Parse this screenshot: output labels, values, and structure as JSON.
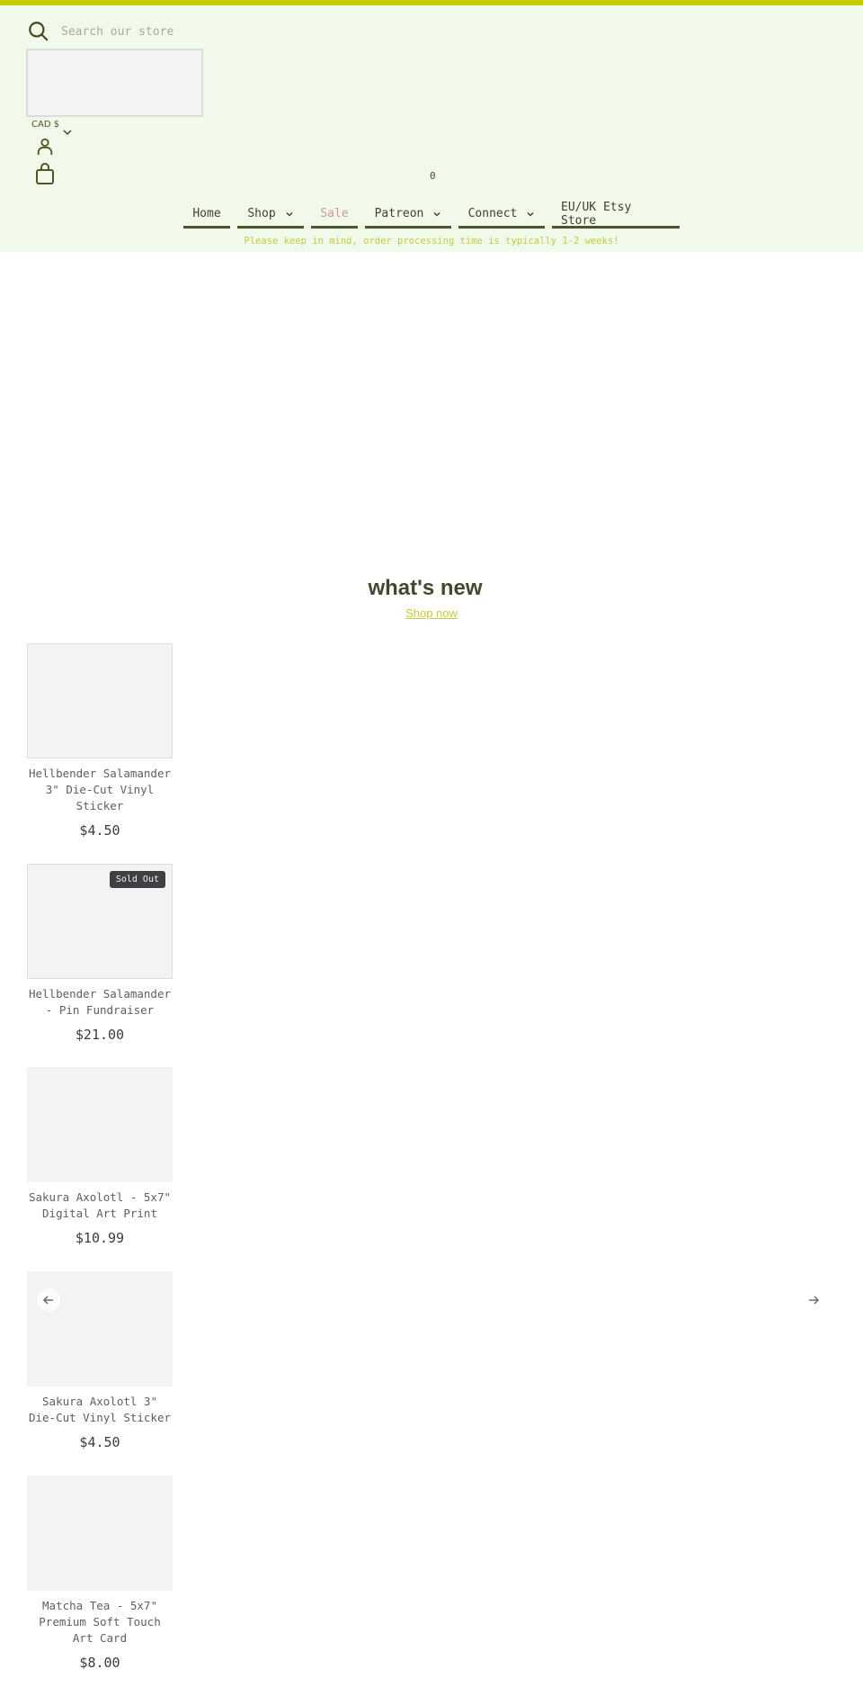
{
  "header": {
    "search": {
      "placeholder": "Search our store",
      "value": ""
    },
    "currency": {
      "selected": "CAD $"
    },
    "cart": {
      "count": "0"
    },
    "nav": [
      {
        "label": "Home",
        "has_dropdown": false
      },
      {
        "label": "Shop",
        "has_dropdown": true
      },
      {
        "label": "Sale",
        "has_dropdown": false,
        "highlight": true
      },
      {
        "label": "Patreon",
        "has_dropdown": true
      },
      {
        "label": "Connect",
        "has_dropdown": true
      },
      {
        "label": "EU/UK Etsy Store",
        "has_dropdown": false
      }
    ],
    "notice": "Please keep in mind, order processing time is typically 1-2 weeks!"
  },
  "colors": {
    "accent_bar": "#c3cc04",
    "header_bg": "#f1f9ea",
    "nav_underline": "#4a5528",
    "sale": "#d09a8c",
    "notice": "#c3cc3a"
  },
  "section": {
    "title": "what's new",
    "link_label": "Shop now"
  },
  "products": [
    {
      "title": "Hellbender Salamander 3\" Die-Cut Vinyl Sticker",
      "price": "$4.50",
      "badge": ""
    },
    {
      "title": "Hellbender Salamander - Pin Fundraiser",
      "price": "$21.00",
      "badge": "Sold Out"
    },
    {
      "title": "Sakura Axolotl - 5x7\" Digital Art Print",
      "price": "$10.99",
      "badge": ""
    },
    {
      "title": "Sakura Axolotl 3\" Die-Cut Vinyl Sticker",
      "price": "$4.50",
      "badge": ""
    },
    {
      "title": "Matcha Tea - 5x7\" Premium Soft Touch Art Card",
      "price": "$8.00",
      "badge": ""
    }
  ],
  "carousel": {
    "prev_icon": "arrow-left-icon",
    "next_icon": "arrow-right-icon"
  }
}
